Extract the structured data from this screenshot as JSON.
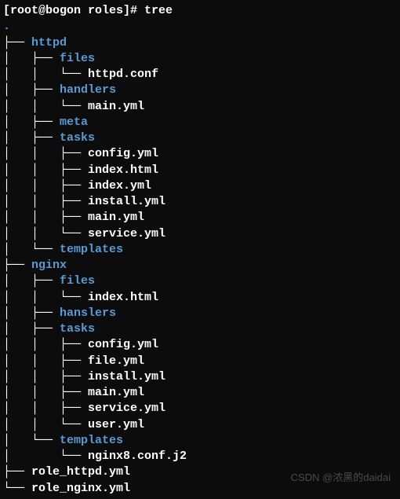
{
  "prompt": {
    "text": "[root@bogon roles]# ",
    "command": "tree"
  },
  "tree": {
    "root_dot": ".",
    "lines": [
      {
        "pipes": "├── ",
        "name": "httpd",
        "type": "dir"
      },
      {
        "pipes": "│   ├── ",
        "name": "files",
        "type": "dir"
      },
      {
        "pipes": "│   │   └── ",
        "name": "httpd.conf",
        "type": "file"
      },
      {
        "pipes": "│   ├── ",
        "name": "handlers",
        "type": "dir"
      },
      {
        "pipes": "│   │   └── ",
        "name": "main.yml",
        "type": "file"
      },
      {
        "pipes": "│   ├── ",
        "name": "meta",
        "type": "dir"
      },
      {
        "pipes": "│   ├── ",
        "name": "tasks",
        "type": "dir"
      },
      {
        "pipes": "│   │   ├── ",
        "name": "config.yml",
        "type": "file"
      },
      {
        "pipes": "│   │   ├── ",
        "name": "index.html",
        "type": "file"
      },
      {
        "pipes": "│   │   ├── ",
        "name": "index.yml",
        "type": "file"
      },
      {
        "pipes": "│   │   ├── ",
        "name": "install.yml",
        "type": "file"
      },
      {
        "pipes": "│   │   ├── ",
        "name": "main.yml",
        "type": "file"
      },
      {
        "pipes": "│   │   └── ",
        "name": "service.yml",
        "type": "file"
      },
      {
        "pipes": "│   └── ",
        "name": "templates",
        "type": "dir"
      },
      {
        "pipes": "├── ",
        "name": "nginx",
        "type": "dir"
      },
      {
        "pipes": "│   ├── ",
        "name": "files",
        "type": "dir"
      },
      {
        "pipes": "│   │   └── ",
        "name": "index.html",
        "type": "file"
      },
      {
        "pipes": "│   ├── ",
        "name": "hanslers",
        "type": "dir"
      },
      {
        "pipes": "│   ├── ",
        "name": "tasks",
        "type": "dir"
      },
      {
        "pipes": "│   │   ├── ",
        "name": "config.yml",
        "type": "file"
      },
      {
        "pipes": "│   │   ├── ",
        "name": "file.yml",
        "type": "file"
      },
      {
        "pipes": "│   │   ├── ",
        "name": "install.yml",
        "type": "file"
      },
      {
        "pipes": "│   │   ├── ",
        "name": "main.yml",
        "type": "file"
      },
      {
        "pipes": "│   │   ├── ",
        "name": "service.yml",
        "type": "file"
      },
      {
        "pipes": "│   │   └── ",
        "name": "user.yml",
        "type": "file"
      },
      {
        "pipes": "│   └── ",
        "name": "templates",
        "type": "dir"
      },
      {
        "pipes": "│       └── ",
        "name": "nginx8.conf.j2",
        "type": "file"
      },
      {
        "pipes": "├── ",
        "name": "role_httpd.yml",
        "type": "file"
      },
      {
        "pipes": "└── ",
        "name": "role_nginx.yml",
        "type": "file"
      }
    ]
  },
  "watermark": "CSDN @浓黑的daidai"
}
